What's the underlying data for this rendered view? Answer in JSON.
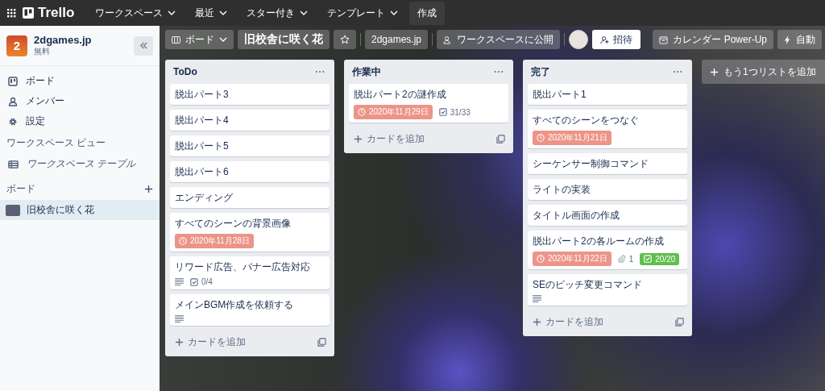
{
  "topbar": {
    "logo": "Trello",
    "menus": [
      {
        "label": "ワークスペース"
      },
      {
        "label": "最近"
      },
      {
        "label": "スター付き"
      },
      {
        "label": "テンプレート"
      }
    ],
    "create": "作成"
  },
  "sidebar": {
    "workspace": {
      "initial": "2",
      "name": "2dgames.jp",
      "plan": "無料"
    },
    "nav": [
      {
        "kind": "board",
        "label": "ボード"
      },
      {
        "kind": "members",
        "label": "メンバー"
      },
      {
        "kind": "settings",
        "label": "設定"
      }
    ],
    "views_heading": "ワークスペース ビュー",
    "views": [
      {
        "kind": "table",
        "label": "ワークスペース テーブル"
      }
    ],
    "boards_heading": "ボード",
    "boards": [
      {
        "label": "旧校舎に咲く花",
        "selected": true
      }
    ]
  },
  "board_header": {
    "view": "ボード",
    "title": "旧校舎に咲く花",
    "starred": false,
    "workspace": "2dgames.jp",
    "visibility": "ワークスペースに公開",
    "invite": "招待",
    "calendar": "カレンダー Power-Up",
    "automation": "自動"
  },
  "lists": [
    {
      "title": "ToDo",
      "add_card": "カードを追加",
      "cards": [
        {
          "title": "脱出パート3"
        },
        {
          "title": "脱出パート4"
        },
        {
          "title": "脱出パート5"
        },
        {
          "title": "脱出パート6"
        },
        {
          "title": "エンディング"
        },
        {
          "title": "すべてのシーンの背景画像",
          "due": "2020年11月28日"
        },
        {
          "title": "リワード広告、バナー広告対応",
          "description": true,
          "checklist": {
            "text": "0/4",
            "complete": false
          }
        },
        {
          "title": "メインBGM作成を依頼する",
          "description": true
        }
      ]
    },
    {
      "title": "作業中",
      "add_card": "カードを追加",
      "cards": [
        {
          "title": "脱出パート2の謎作成",
          "due": "2020年11月29日",
          "checklist": {
            "text": "31/33",
            "complete": false
          }
        }
      ]
    },
    {
      "title": "完了",
      "add_card": "カードを追加",
      "cards": [
        {
          "title": "脱出パート1"
        },
        {
          "title": "すべてのシーンをつなぐ",
          "due": "2020年11月21日"
        },
        {
          "title": "シーケンサー制御コマンド"
        },
        {
          "title": "ライトの実装"
        },
        {
          "title": "タイトル画面の作成"
        },
        {
          "title": "脱出パート2の各ルームの作成",
          "due": "2020年11月22日",
          "attachments": "1",
          "checklist": {
            "text": "20/20",
            "complete": true
          }
        },
        {
          "title": "SEのピッチ変更コマンド",
          "description": true
        }
      ]
    }
  ],
  "add_list": "もう1つリストを追加"
}
